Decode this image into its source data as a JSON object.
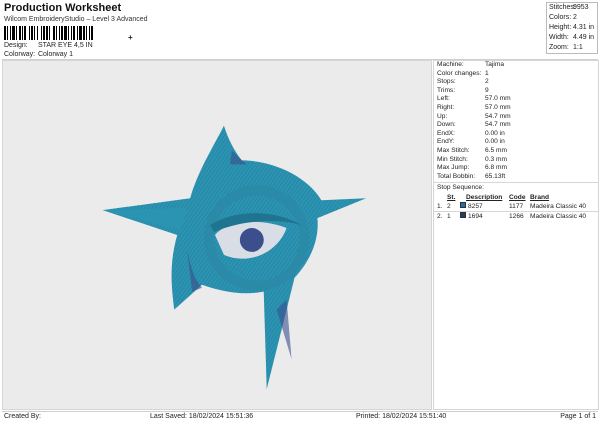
{
  "header": {
    "title": "Production Worksheet",
    "subtitle": "Wilcom EmbroideryStudio – Level 3 Advanced",
    "barcode_mark": "+"
  },
  "meta": {
    "design_label": "Design:",
    "design_value": "STAR EYE 4,5 IN",
    "colorway_label": "Colorway:",
    "colorway_value": "Colorway 1"
  },
  "stats": {
    "stitches_label": "Stitches:",
    "stitches_value": "9953",
    "colors_label": "Colors:",
    "colors_value": "2",
    "height_label": "Height:",
    "height_value": "4.31 in",
    "width_label": "Width:",
    "width_value": "4.49 in",
    "zoom_label": "Zoom:",
    "zoom_value": "1:1"
  },
  "info": {
    "machine_label": "Machine:",
    "machine_value": "Tajima",
    "color_changes_label": "Color changes:",
    "color_changes_value": "1",
    "stops_label": "Stops:",
    "stops_value": "2",
    "trims_label": "Trims:",
    "trims_value": "9",
    "left_label": "Left:",
    "left_value": "57.0 mm",
    "right_label": "Right:",
    "right_value": "57.0 mm",
    "up_label": "Up:",
    "up_value": "54.7 mm",
    "down_label": "Down:",
    "down_value": "54.7 mm",
    "endx_label": "EndX:",
    "endx_value": "0.00 in",
    "endy_label": "EndY:",
    "endy_value": "0.00 in",
    "max_stitch_label": "Max Stitch:",
    "max_stitch_value": "6.5 mm",
    "min_stitch_label": "Min Stitch:",
    "min_stitch_value": "0.3 mm",
    "max_jump_label": "Max Jump:",
    "max_jump_value": "6.8 mm",
    "total_bobbin_label": "Total Bobbin:",
    "total_bobbin_value": "65.13ft"
  },
  "stop_sequence": {
    "title": "Stop Sequence:",
    "columns": {
      "st": "St.",
      "description": "Description",
      "code": "Code",
      "brand": "Brand"
    },
    "rows": [
      {
        "n": "1.",
        "st": "2",
        "color": "#1f6fb0",
        "description": "8257",
        "code": "1177",
        "brand": "Madeira Classic 40"
      },
      {
        "n": "2.",
        "st": "1",
        "color": "#233a6b",
        "description": "1694",
        "code": "1266",
        "brand": "Madeira Classic 40"
      }
    ]
  },
  "design_colors": {
    "teal": "#2c94b3",
    "teal_dark": "#1f7590",
    "eye_blue": "#3a4f8c",
    "eye_light": "#d8dde6",
    "canvas": "#ebebeb"
  },
  "footer": {
    "created_by": "Created By:",
    "last_saved": "Last Saved: 18/02/2024 15:51:36",
    "printed": "Printed: 18/02/2024 15:51:40",
    "page": "Page 1 of 1"
  }
}
